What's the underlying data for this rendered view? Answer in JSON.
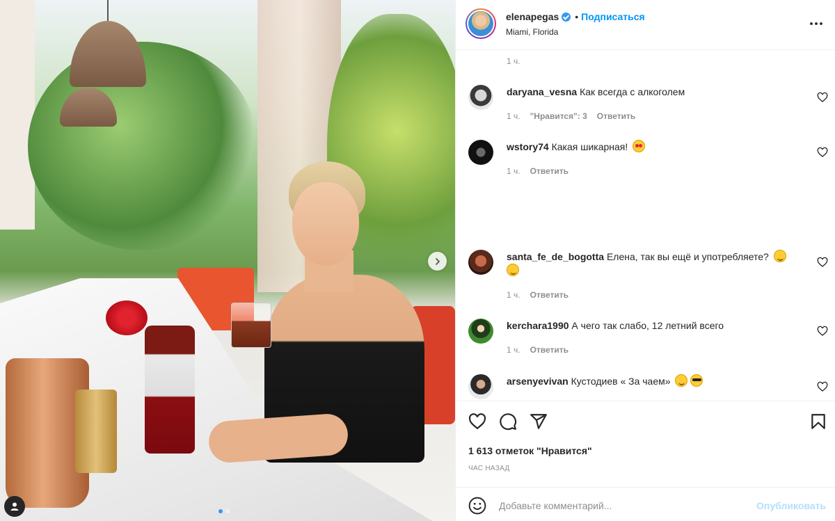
{
  "post": {
    "username": "elenapegas",
    "separator": "•",
    "follow_label": "Подписаться",
    "location": "Miami, Florida"
  },
  "icons": {
    "more": "more-horizontal-icon",
    "next": "chevron-right-icon",
    "tag": "user-tag-icon",
    "like": "heart-outline-icon",
    "comment": "speech-bubble-icon",
    "share": "paper-plane-icon",
    "save": "bookmark-icon",
    "emoji": "smiley-icon",
    "verified": "verified-badge-icon"
  },
  "first_time": "1 ч.",
  "comments": [
    {
      "user": "daryana_vesna",
      "text": "Как всегда с алкоголем",
      "time": "1 ч.",
      "likes": "\"Нравится\": 3",
      "reply": "Ответить"
    },
    {
      "user": "wstory74",
      "text": "Какая шикарная!",
      "time": "1 ч.",
      "reply": "Ответить"
    },
    {
      "user": "santa_fe_de_bogotta",
      "text": "Елена, так вы ещё и употребляете?",
      "time": "1 ч.",
      "reply": "Ответить"
    },
    {
      "user": "kerchara1990",
      "text": "А чего так слабо, 12 летний всего",
      "time": "1 ч.",
      "reply": "Ответить"
    },
    {
      "user": "arsenyevivan",
      "text": "Кустодиев « За чаем»",
      "time": "",
      "reply": ""
    }
  ],
  "likes_text": "1 613 отметок \"Нравится\"",
  "posted_ago": "ЧАС НАЗАД",
  "add_comment": {
    "placeholder": "Добавьте комментарий...",
    "publish_label": "Опубликовать"
  },
  "colors": {
    "accent": "#0095f6",
    "publish_disabled": "#b2dffc",
    "muted": "#8e8e8e",
    "text": "#262626"
  },
  "carousel": {
    "slides": 2,
    "current": 1
  }
}
